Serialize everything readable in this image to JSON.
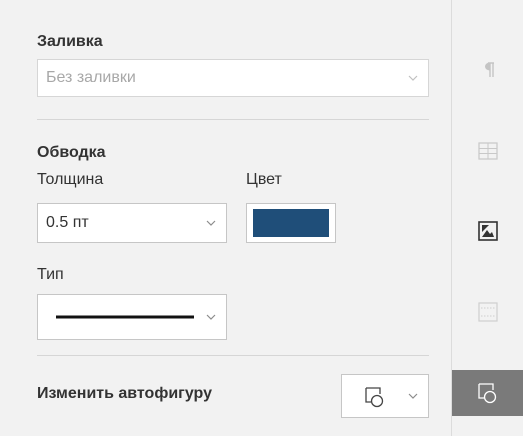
{
  "fill": {
    "title": "Заливка",
    "value": "Без заливки"
  },
  "stroke": {
    "title": "Обводка",
    "thickness_label": "Толщина",
    "thickness_value": "0.5 пт",
    "color_label": "Цвет",
    "color_value": "#1f4e79",
    "type_label": "Тип"
  },
  "shape": {
    "label": "Изменить автофигуру"
  },
  "rail": {
    "items": [
      {
        "name": "paragraph-settings",
        "icon": "paragraph-icon",
        "active": false
      },
      {
        "name": "table-settings",
        "icon": "table-icon",
        "active": false
      },
      {
        "name": "image-settings",
        "icon": "image-icon",
        "active": false
      },
      {
        "name": "header-footer-settings",
        "icon": "header-footer-icon",
        "active": false
      },
      {
        "name": "shape-settings",
        "icon": "shape-icon",
        "active": true
      }
    ]
  },
  "colors": {
    "panel_bg": "#f2f2f2",
    "border": "#c6c6c6",
    "stroke_color": "#1f4e79",
    "rail_active": "#7a7a7a"
  }
}
